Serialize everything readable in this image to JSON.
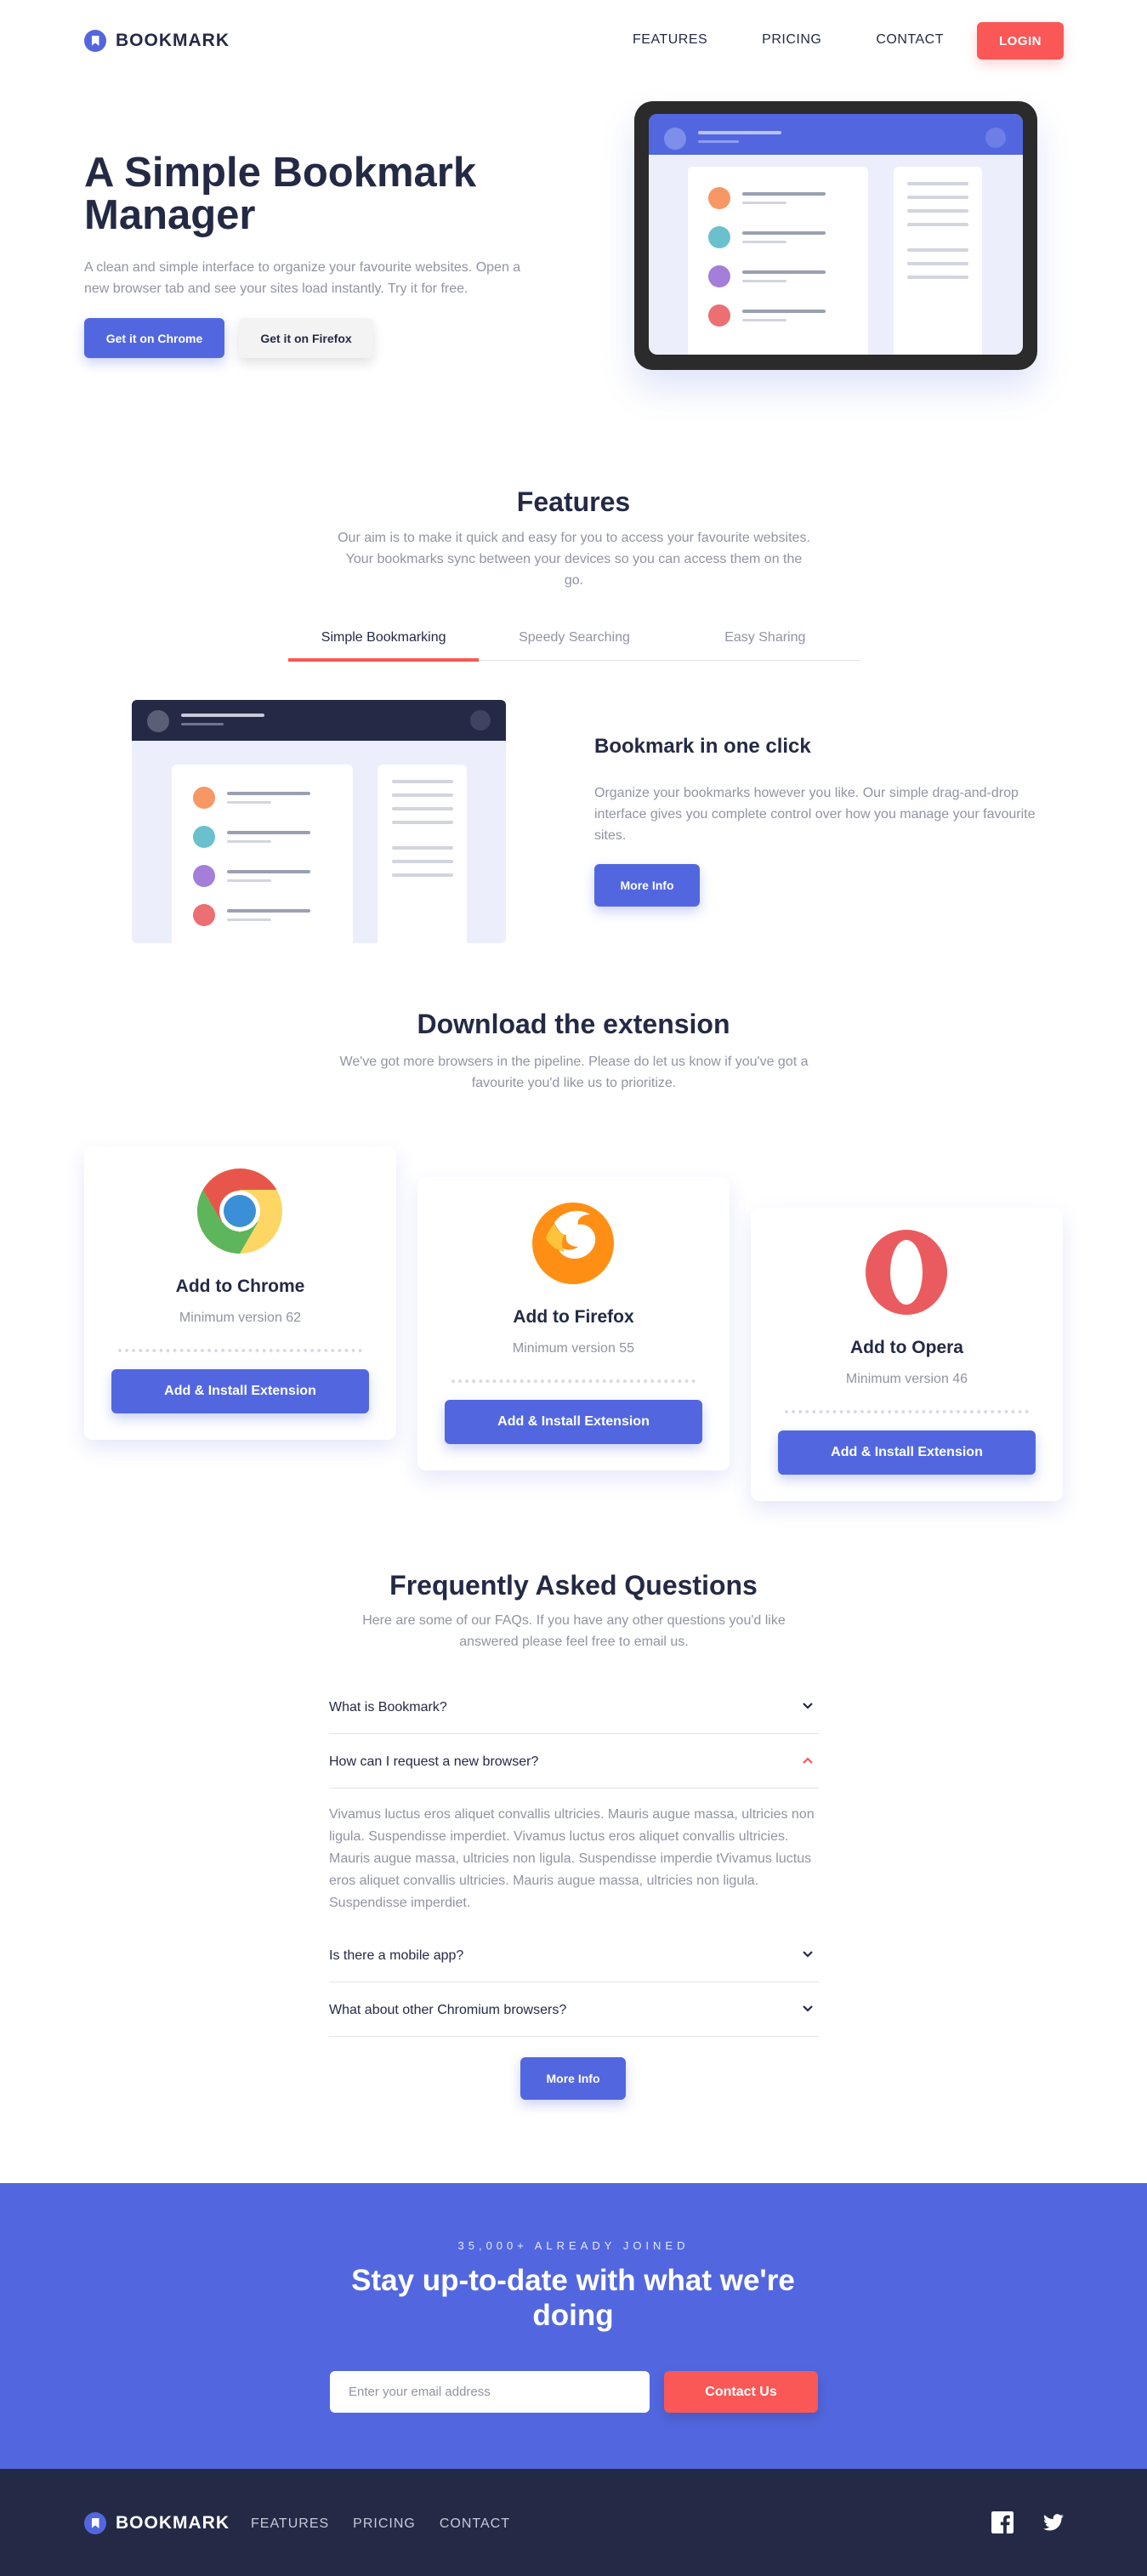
{
  "nav": {
    "brand": "BOOKMARK",
    "links": [
      "FEATURES",
      "PRICING",
      "CONTACT"
    ],
    "login": "LOGIN"
  },
  "hero": {
    "title": "A Simple Bookmark Manager",
    "subtitle": "A clean and simple interface to organize your favourite websites. Open a new browser tab and see your sites load instantly. Try it for free.",
    "btn_chrome": "Get it on Chrome",
    "btn_firefox": "Get it on Firefox"
  },
  "features": {
    "title": "Features",
    "subtitle": "Our aim is to make it quick and easy for you to access your favourite websites. Your bookmarks sync between your devices so you can access them on the go.",
    "tabs": [
      "Simple Bookmarking",
      "Speedy Searching",
      "Easy Sharing"
    ],
    "active_tab": 0,
    "panel_title": "Bookmark in one click",
    "panel_desc": "Organize your bookmarks however you like. Our simple drag-and-drop interface gives you complete control over how you manage your favourite sites.",
    "more_info": "More Info"
  },
  "download": {
    "title": "Download the extension",
    "subtitle": "We've got more browsers in the pipeline. Please do let us know if you've got a favourite you'd like us to prioritize.",
    "cards": [
      {
        "title": "Add to Chrome",
        "version": "Minimum version 62",
        "button": "Add & Install Extension",
        "icon": "chrome-icon"
      },
      {
        "title": "Add to Firefox",
        "version": "Minimum version 55",
        "button": "Add & Install Extension",
        "icon": "firefox-icon"
      },
      {
        "title": "Add to Opera",
        "version": "Minimum version 46",
        "button": "Add & Install Extension",
        "icon": "opera-icon"
      }
    ]
  },
  "faq": {
    "title": "Frequently Asked Questions",
    "subtitle": "Here are some of our FAQs. If you have any other questions you'd like answered please feel free to email us.",
    "items": [
      {
        "q": "What is Bookmark?",
        "open": false
      },
      {
        "q": "How can I request a new browser?",
        "open": true,
        "a": "Vivamus luctus eros aliquet convallis ultricies. Mauris augue massa, ultricies non ligula. Suspendisse imperdiet. Vivamus luctus eros aliquet convallis ultricies. Mauris augue massa, ultricies non ligula. Suspendisse imperdie tVivamus luctus eros aliquet convallis ultricies. Mauris augue massa, ultricies non ligula. Suspendisse imperdiet."
      },
      {
        "q": "Is there a mobile app?",
        "open": false
      },
      {
        "q": "What about other Chromium browsers?",
        "open": false
      }
    ],
    "more_info": "More Info"
  },
  "cta": {
    "eyebrow": "35,000+ ALREADY JOINED",
    "title": "Stay up-to-date with what we're doing",
    "placeholder": "Enter your email address",
    "button": "Contact Us"
  },
  "footer": {
    "brand": "BOOKMARK",
    "links": [
      "FEATURES",
      "PRICING",
      "CONTACT"
    ],
    "social": [
      "facebook-icon",
      "twitter-icon"
    ]
  },
  "colors": {
    "primary": "#5267df",
    "accent": "#fa5757",
    "dark": "#242a45",
    "muted": "#9194a2"
  }
}
